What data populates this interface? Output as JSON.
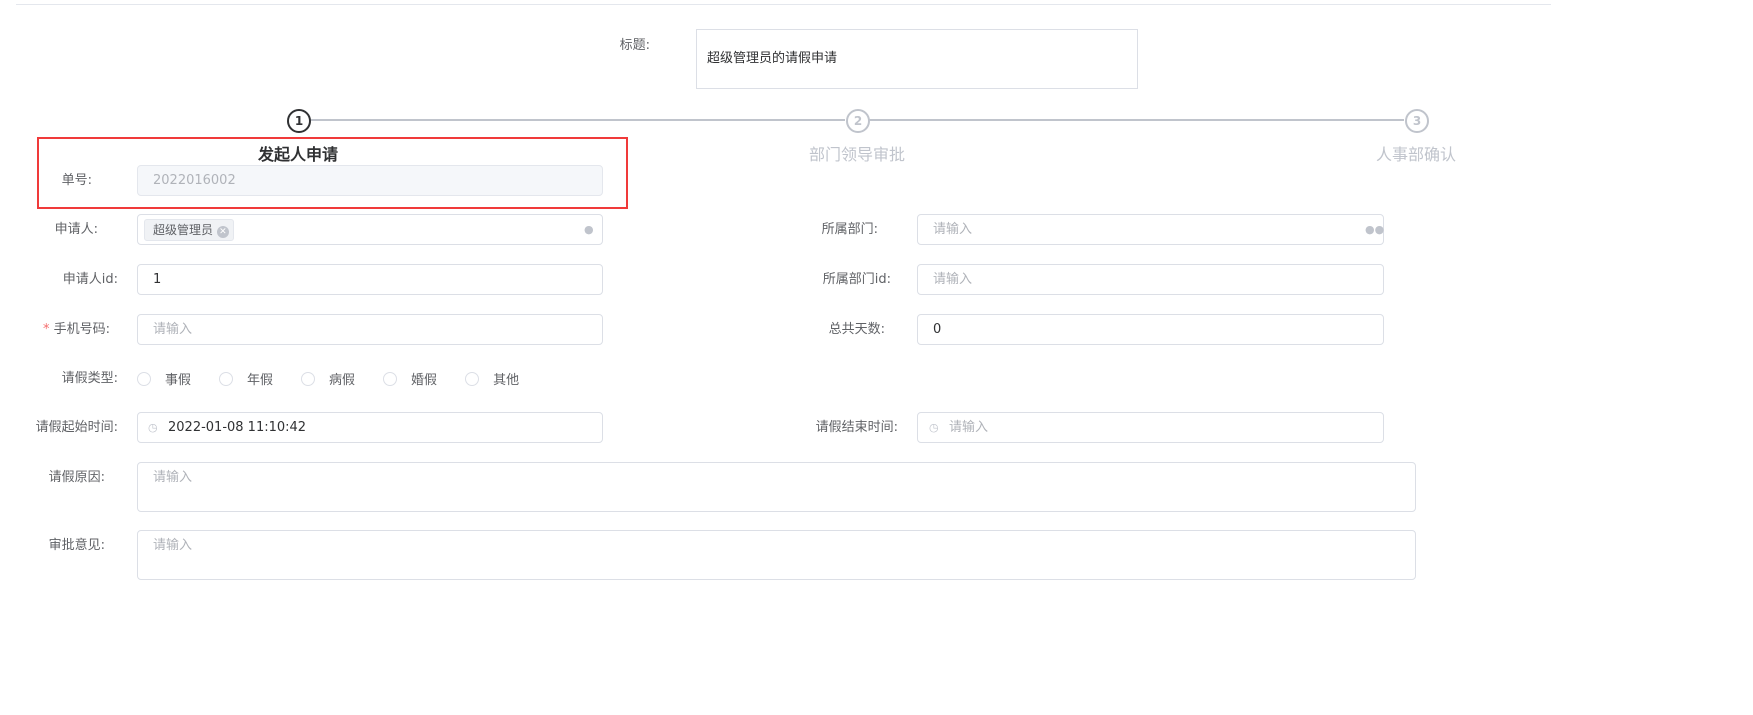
{
  "header": {
    "title_label": "标题:",
    "title_value": "超级管理员的请假申请"
  },
  "steps": [
    {
      "num": "1",
      "title": "发起人申请"
    },
    {
      "num": "2",
      "title": "部门领导审批"
    },
    {
      "num": "3",
      "title": "人事部确认"
    }
  ],
  "form": {
    "order_no": {
      "label": "单号:",
      "value": "2022016002"
    },
    "applicant": {
      "label": "申请人:",
      "tag": "超级管理员"
    },
    "department": {
      "label": "所属部门:",
      "placeholder": "请输入"
    },
    "applicant_id": {
      "label": "申请人id:",
      "value": "1"
    },
    "department_id": {
      "label": "所属部门id:",
      "placeholder": "请输入"
    },
    "phone": {
      "required": "*",
      "label": "手机号码:",
      "placeholder": "请输入"
    },
    "total_days": {
      "label": "总共天数:",
      "value": "0"
    },
    "leave_type": {
      "label": "请假类型:",
      "options": [
        "事假",
        "年假",
        "病假",
        "婚假",
        "其他"
      ]
    },
    "start_time": {
      "label": "请假起始时间:",
      "value": "2022-01-08 11:10:42"
    },
    "end_time": {
      "label": "请假结束时间:",
      "placeholder": "请输入"
    },
    "reason": {
      "label": "请假原因:",
      "placeholder": "请输入"
    },
    "opinion": {
      "label": "审批意见:",
      "placeholder": "请输入"
    }
  },
  "colors": {
    "highlight": "#f03a3a"
  }
}
